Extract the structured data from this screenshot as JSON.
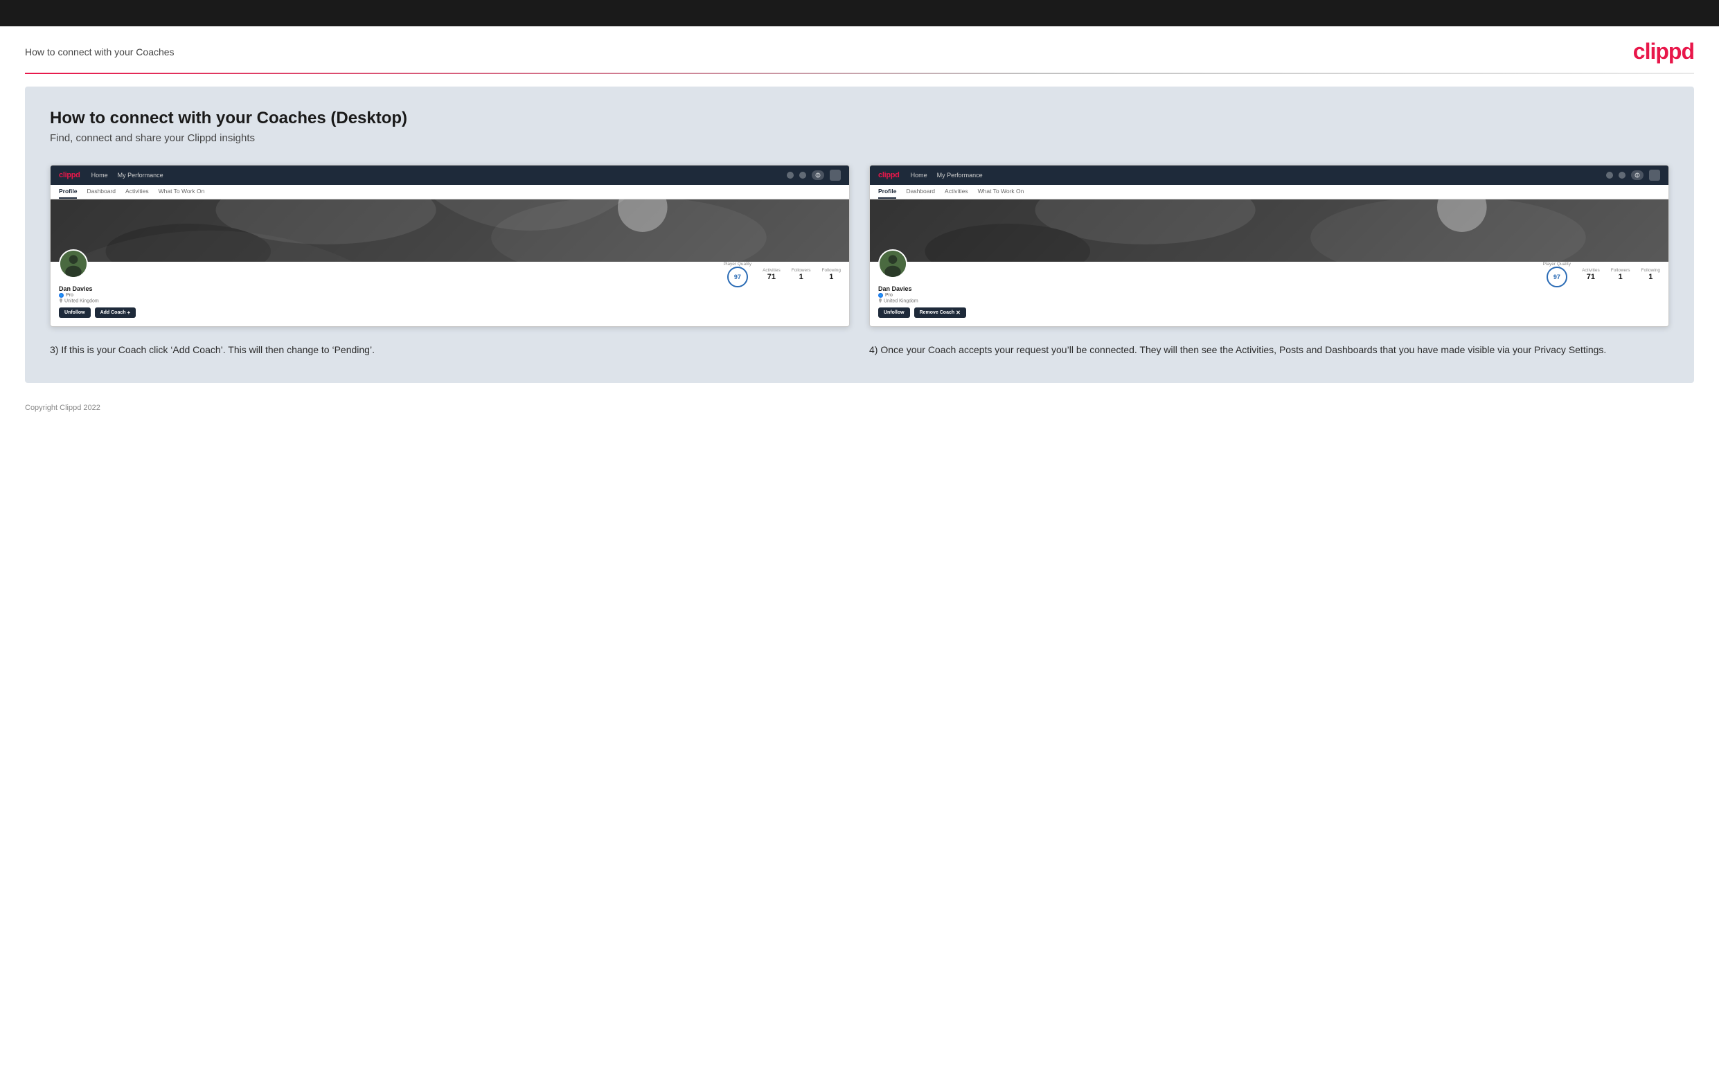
{
  "topBar": {},
  "header": {
    "title": "How to connect with your Coaches",
    "logo": "clippd"
  },
  "main": {
    "title": "How to connect with your Coaches (Desktop)",
    "subtitle": "Find, connect and share your Clippd insights",
    "step3": {
      "description": "3) If this is your Coach click ‘Add Coach’. This will then change to ‘Pending’."
    },
    "step4": {
      "description": "4) Once your Coach accepts your request you’ll be connected. They will then see the Activities, Posts and Dashboards that you have made visible via your Privacy Settings."
    }
  },
  "screenshot1": {
    "nav": {
      "logo": "clippd",
      "links": [
        "Home",
        "My Performance"
      ]
    },
    "tabs": [
      "Profile",
      "Dashboard",
      "Activities",
      "What To Work On"
    ],
    "activeTab": "Profile",
    "user": {
      "name": "Dan Davies",
      "badge": "Pro",
      "location": "United Kingdom",
      "playerQuality": "97",
      "playerQualityLabel": "Player Quality",
      "activities": "71",
      "activitiesLabel": "Activities",
      "followers": "1",
      "followersLabel": "Followers",
      "following": "1",
      "followingLabel": "Following"
    },
    "buttons": {
      "unfollow": "Unfollow",
      "addCoach": "Add Coach"
    }
  },
  "screenshot2": {
    "nav": {
      "logo": "clippd",
      "links": [
        "Home",
        "My Performance"
      ]
    },
    "tabs": [
      "Profile",
      "Dashboard",
      "Activities",
      "What To Work On"
    ],
    "activeTab": "Profile",
    "user": {
      "name": "Dan Davies",
      "badge": "Pro",
      "location": "United Kingdom",
      "playerQuality": "97",
      "playerQualityLabel": "Player Quality",
      "activities": "71",
      "activitiesLabel": "Activities",
      "followers": "1",
      "followersLabel": "Followers",
      "following": "1",
      "followingLabel": "Following"
    },
    "buttons": {
      "unfollow": "Unfollow",
      "removeCoach": "Remove Coach"
    }
  },
  "footer": {
    "copyright": "Copyright Clippd 2022"
  }
}
